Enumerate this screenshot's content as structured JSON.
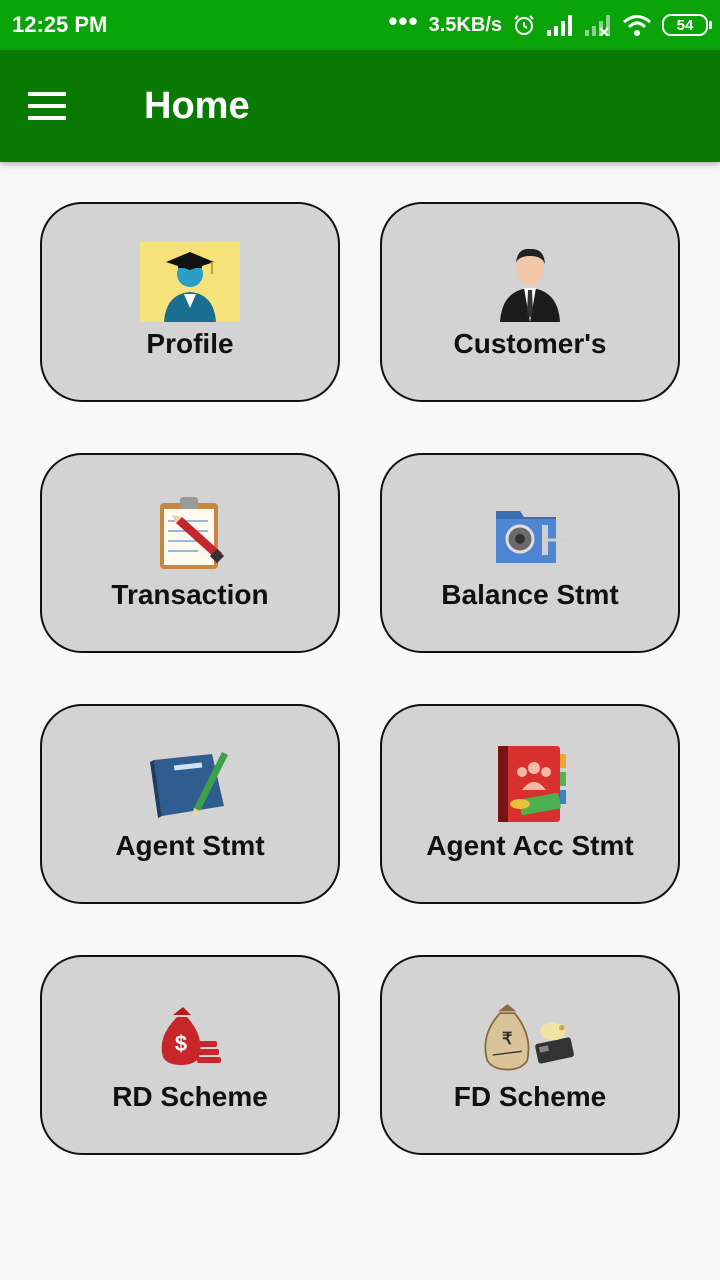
{
  "status_bar": {
    "time": "12:25 PM",
    "dots": "•••",
    "speed": "3.5KB/s",
    "battery": "54"
  },
  "app_bar": {
    "title": "Home"
  },
  "tiles": [
    {
      "label": "Profile",
      "icon": "graduate-profile-icon"
    },
    {
      "label": "Customer's",
      "icon": "businessman-icon"
    },
    {
      "label": "Transaction",
      "icon": "clipboard-pencil-icon"
    },
    {
      "label": "Balance Stmt",
      "icon": "safe-folder-icon"
    },
    {
      "label": "Agent Stmt",
      "icon": "book-pencil-icon"
    },
    {
      "label": "Agent Acc Stmt",
      "icon": "address-book-money-icon"
    },
    {
      "label": "RD Scheme",
      "icon": "money-bag-coins-icon"
    },
    {
      "label": "FD Scheme",
      "icon": "fixed-deposit-bag-icon"
    }
  ]
}
